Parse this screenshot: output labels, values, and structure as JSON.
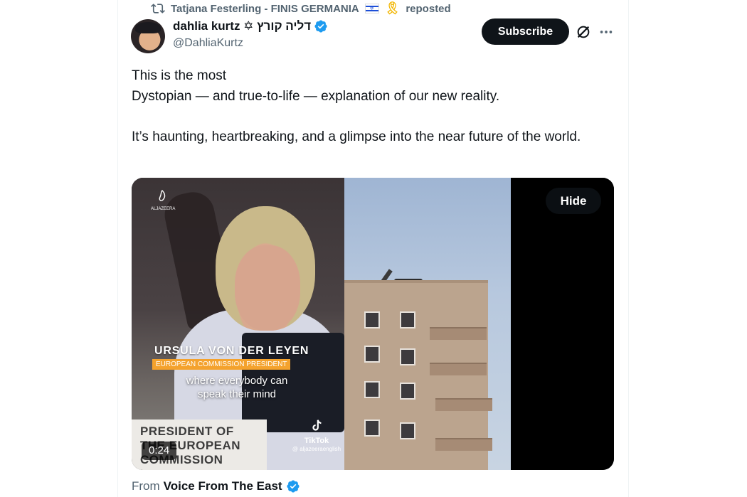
{
  "repost": {
    "icon": "repost-icon",
    "user": "Tatjana Festerling - FINIS GERMANIA",
    "flag": "israel-flag",
    "ribbon": "yellow-ribbon",
    "label": "reposted"
  },
  "author": {
    "name": "dahlia kurtz ✡ דליה קורץ",
    "handle": "@DahliaKurtz",
    "verified": true,
    "verified_color": "#1d9bf0"
  },
  "actions": {
    "subscribe_label": "Subscribe",
    "grok_icon": "grok-icon",
    "more_icon": "more-icon"
  },
  "tweet": {
    "line1": "This is the most",
    "line2": "Dystopian — and true-to-life — explanation of our new reality.",
    "paragraph2": "It’s haunting, heartbreaking, and a glimpse into the near future of the world."
  },
  "media": {
    "hide_label": "Hide",
    "duration": "0:24",
    "lower_third_name": "URSULA VON DER LEYEN",
    "lower_third_role": "EUROPEAN COMMISSION PRESIDENT",
    "subtitle": "where everybody can speak their mind",
    "nameplate": "PRESIDENT OF THE EUROPEAN COMMISSION",
    "channel_logo_text": "ALJAZEERA",
    "tiktok_label": "TikTok",
    "tiktok_handle": "@ aljazeeraenglish"
  },
  "footer": {
    "from_label": "From",
    "source": "Voice From The East",
    "source_verified": true
  },
  "colors": {
    "text_primary": "#0f1419",
    "text_secondary": "#536471",
    "accent": "#1d9bf0",
    "lower_third_orange": "#f4a22d"
  }
}
